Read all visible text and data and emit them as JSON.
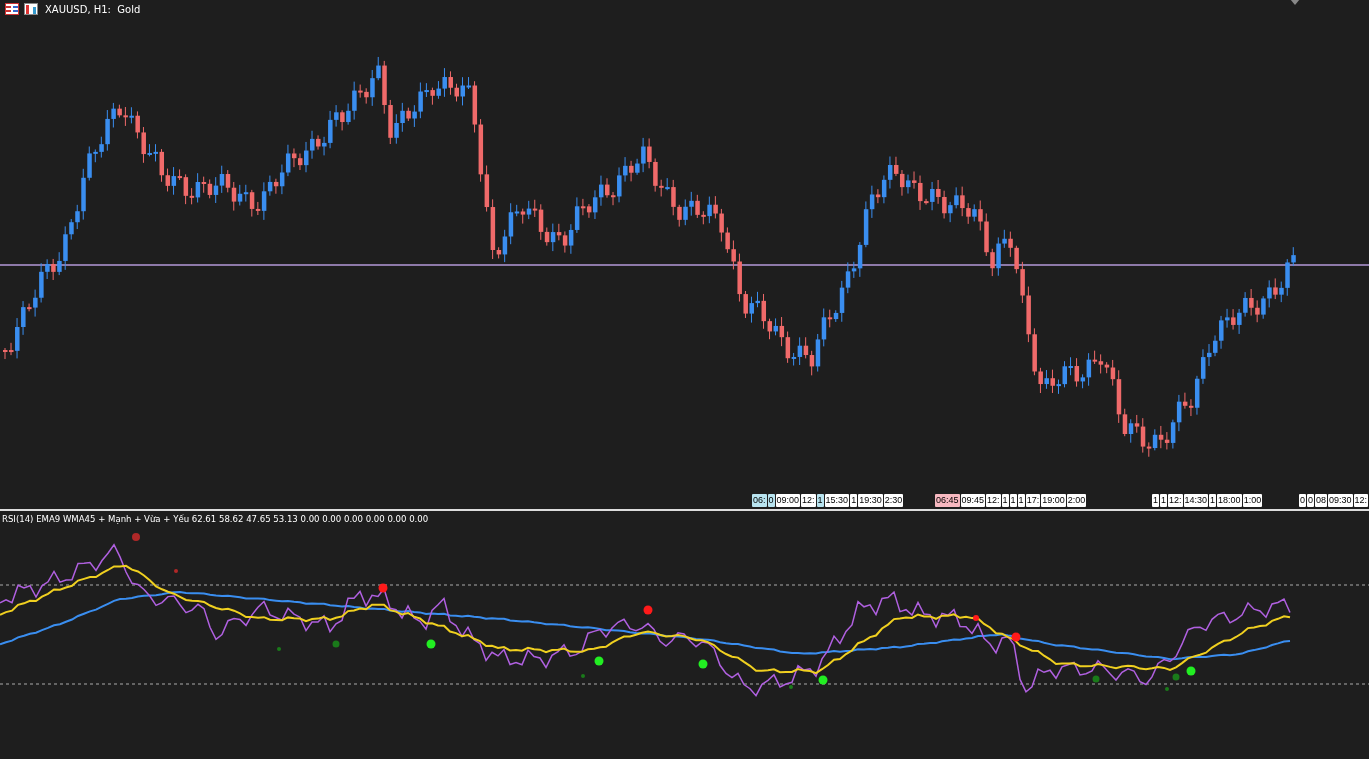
{
  "window": {
    "title": "XAUUSD, H1:  Gold"
  },
  "time_scale": [
    {
      "tags": [
        {
          "text": "06:",
          "color": "#b8e4f0"
        },
        {
          "text": "0",
          "color": "#b8e4f0"
        },
        {
          "text": "09:00",
          "color": "#ffffff"
        },
        {
          "text": "12:",
          "color": "#ffffff"
        },
        {
          "text": "1",
          "color": "#b8e4f0"
        },
        {
          "text": "15:30",
          "color": "#ffffff"
        },
        {
          "text": "1",
          "color": "#ffffff"
        },
        {
          "text": "19:30",
          "color": "#ffffff"
        },
        {
          "text": "2:30",
          "color": "#ffffff"
        }
      ]
    },
    {
      "tags": [
        {
          "text": "06:45",
          "color": "#f7b8c0"
        },
        {
          "text": "09:45",
          "color": "#ffffff"
        },
        {
          "text": "12:",
          "color": "#ffffff"
        },
        {
          "text": "1",
          "color": "#ffffff"
        },
        {
          "text": "1",
          "color": "#ffffff"
        },
        {
          "text": "1",
          "color": "#ffffff"
        },
        {
          "text": "17:",
          "color": "#ffffff"
        },
        {
          "text": "19:00",
          "color": "#ffffff"
        },
        {
          "text": "2:00",
          "color": "#ffffff"
        }
      ]
    },
    {
      "tags": [
        {
          "text": "1",
          "color": "#ffffff"
        },
        {
          "text": "1",
          "color": "#ffffff"
        },
        {
          "text": "12:",
          "color": "#ffffff"
        },
        {
          "text": "14:30",
          "color": "#ffffff"
        },
        {
          "text": "1",
          "color": "#ffffff"
        },
        {
          "text": "18:00",
          "color": "#ffffff"
        },
        {
          "text": "1:00",
          "color": "#ffffff"
        }
      ]
    },
    {
      "tags": [
        {
          "text": "0",
          "color": "#ffffff"
        },
        {
          "text": "0",
          "color": "#ffffff"
        },
        {
          "text": "08",
          "color": "#ffffff"
        },
        {
          "text": "09:30",
          "color": "#ffffff"
        },
        {
          "text": "12:",
          "color": "#ffffff"
        }
      ]
    }
  ],
  "indicator": {
    "label": "RSI(14) EMA9 WMA45 + Mạnh + Vừa + Yếu 62.61 58.62 47.65 53.13 0.00 0.00 0.00 0.00 0.00 0.00"
  }
}
